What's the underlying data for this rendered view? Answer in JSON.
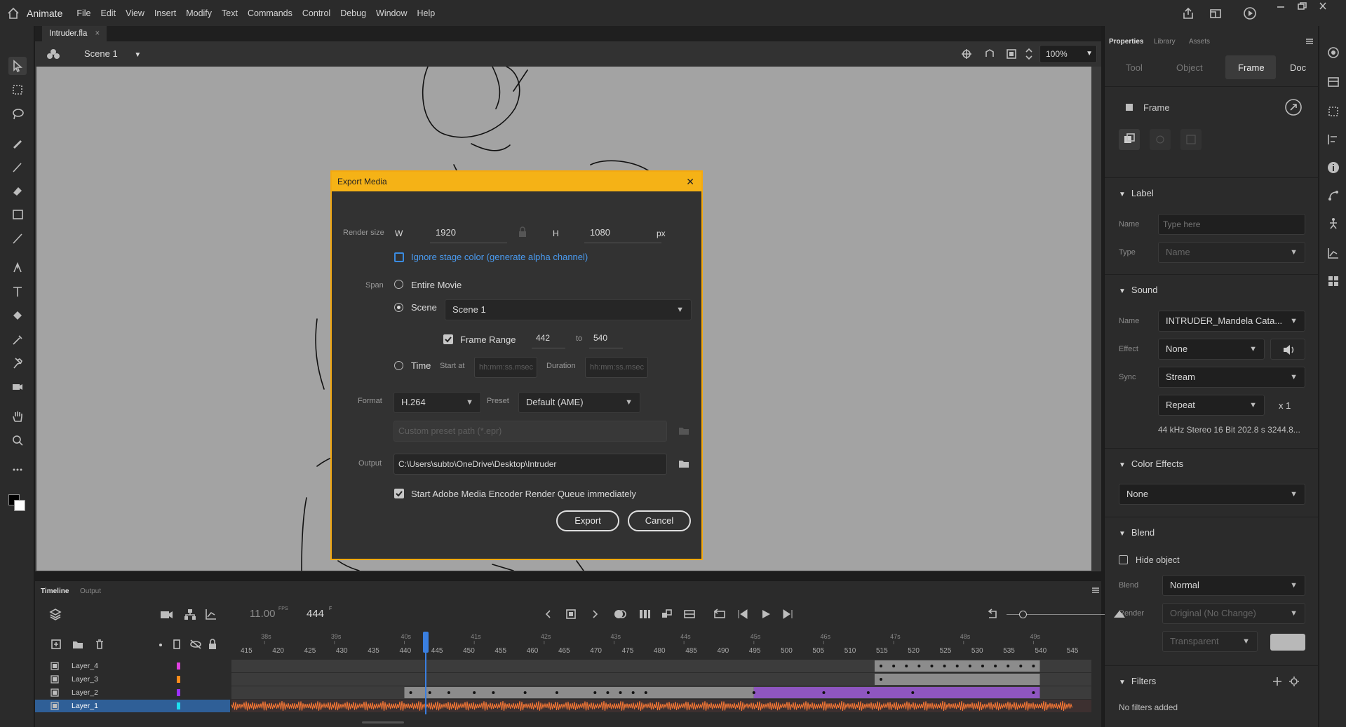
{
  "app": {
    "name": "Animate",
    "menu": [
      "File",
      "Edit",
      "View",
      "Insert",
      "Modify",
      "Text",
      "Commands",
      "Control",
      "Debug",
      "Window",
      "Help"
    ]
  },
  "document": {
    "tab": "Intruder.fla",
    "tab_close": "×",
    "scene": "Scene 1",
    "zoom": "100%"
  },
  "properties": {
    "tabs": [
      "Properties",
      "Library",
      "Assets"
    ],
    "subtabs": [
      "Tool",
      "Object",
      "Frame",
      "Doc"
    ],
    "active_subtab": "Frame",
    "header": "Frame",
    "label": {
      "title": "Label",
      "name_label": "Name",
      "name_placeholder": "Type here",
      "type_label": "Type",
      "type_value": "Name"
    },
    "sound": {
      "title": "Sound",
      "name_label": "Name",
      "name_value": "INTRUDER_Mandela Cata...",
      "effect_label": "Effect",
      "effect_value": "None",
      "sync_label": "Sync",
      "sync_value": "Stream",
      "repeat_value": "Repeat",
      "repeat_count": "x 1",
      "info": "44 kHz Stereo 16 Bit 202.8 s 3244.8..."
    },
    "color_effects": {
      "title": "Color Effects",
      "value": "None"
    },
    "blend": {
      "title": "Blend",
      "hide_object": "Hide object",
      "blend_label": "Blend",
      "blend_value": "Normal",
      "render_label": "Render",
      "render_value": "Original (No Change)",
      "transparent_value": "Transparent"
    },
    "filters": {
      "title": "Filters",
      "empty": "No filters added"
    }
  },
  "timeline": {
    "tabs": [
      "Timeline",
      "Output"
    ],
    "fps": "11.00",
    "fps_unit": "FPS",
    "frame": "444",
    "frame_unit": "F",
    "seconds": [
      "38s",
      "39s",
      "40s",
      "41s",
      "42s",
      "43s",
      "44s",
      "45s",
      "46s",
      "47s",
      "48s",
      "49s"
    ],
    "frame_ticks": [
      "415",
      "420",
      "425",
      "430",
      "435",
      "440",
      "445",
      "450",
      "455",
      "460",
      "465",
      "470",
      "475",
      "480",
      "485",
      "490",
      "495",
      "500",
      "505",
      "510",
      "515",
      "520",
      "525",
      "530",
      "535",
      "540",
      "545"
    ],
    "layers": [
      {
        "name": "Layer_4",
        "color": "#e040e0"
      },
      {
        "name": "Layer_3",
        "color": "#ff8c1a"
      },
      {
        "name": "Layer_2",
        "color": "#9b30ff"
      },
      {
        "name": "Layer_1",
        "color": "#1ee0f0"
      }
    ]
  },
  "dialog": {
    "title": "Export Media",
    "close": "✕",
    "render_size_label": "Render size",
    "w_label": "W",
    "w_value": "1920",
    "h_label": "H",
    "h_value": "1080",
    "px_label": "px",
    "ignore_stage": "Ignore stage color (generate alpha channel)",
    "span_label": "Span",
    "entire_movie": "Entire Movie",
    "scene_label": "Scene",
    "scene_value": "Scene 1",
    "frame_range_label": "Frame Range",
    "frame_from": "442",
    "frame_to_label": "to",
    "frame_to": "540",
    "time_label": "Time",
    "start_at_label": "Start at",
    "start_placeholder": "hh:mm:ss.msec",
    "duration_label": "Duration",
    "duration_placeholder": "hh:mm:ss.msec",
    "format_label": "Format",
    "format_value": "H.264",
    "preset_label": "Preset",
    "preset_value": "Default (AME)",
    "custom_preset_placeholder": "Custom preset path (*.epr)",
    "output_label": "Output",
    "output_value": "C:\\Users\\subto\\OneDrive\\Desktop\\Intruder",
    "start_ame": "Start Adobe Media Encoder Render Queue immediately",
    "export_button": "Export",
    "cancel_button": "Cancel"
  }
}
